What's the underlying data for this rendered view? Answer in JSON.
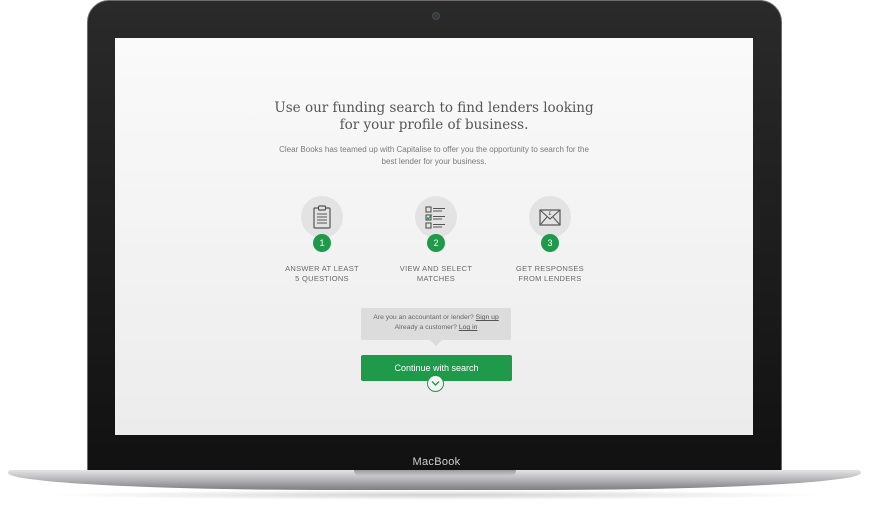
{
  "page": {
    "headline": "Use our funding search to find lenders looking for your profile of business.",
    "subtext": "Clear Books has teamed up with Capitalise to offer you the opportunity to search for the best lender for your business."
  },
  "steps": [
    {
      "number": "1",
      "label_line1": "ANSWER AT LEAST",
      "label_line2": "5 QUESTIONS",
      "icon": "clipboard-icon"
    },
    {
      "number": "2",
      "label_line1": "VIEW AND SELECT",
      "label_line2": "MATCHES",
      "icon": "checklist-icon"
    },
    {
      "number": "3",
      "label_line1": "GET RESPONSES",
      "label_line2": "FROM LENDERS",
      "icon": "envelope-icon"
    }
  ],
  "tooltip": {
    "line1_text": "Are you an accountant or lender?",
    "line1_link": "Sign up",
    "line2_text": "Already a customer?",
    "line2_link": "Log in"
  },
  "cta": {
    "label": "Continue with search"
  },
  "device": {
    "label": "MacBook"
  },
  "colors": {
    "accent": "#1f9a4b",
    "icon_bg": "#e3e3e3"
  }
}
